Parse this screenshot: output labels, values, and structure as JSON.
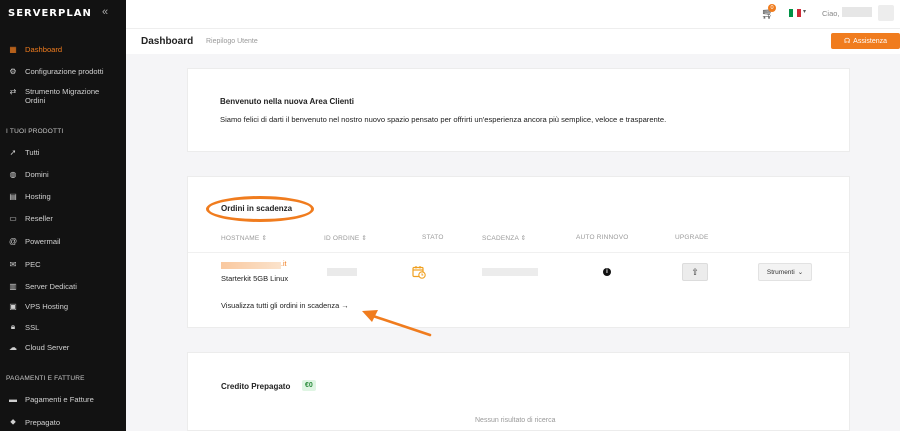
{
  "brand": {
    "logo": "SERVERPLAN",
    "collapse_icon": "«"
  },
  "sidebar": {
    "top_items": [
      {
        "label": "Dashboard",
        "icon": "grid-icon",
        "active": true
      },
      {
        "label": "Configurazione prodotti",
        "icon": "sliders-icon"
      },
      {
        "label": "Strumento Migrazione Ordini",
        "icon": "migrate-icon"
      }
    ],
    "section_products": "I TUOI PRODOTTI",
    "products": [
      {
        "label": "Tutti",
        "icon": "rocket-icon"
      },
      {
        "label": "Domini",
        "icon": "globe-icon"
      },
      {
        "label": "Hosting",
        "icon": "server-icon"
      },
      {
        "label": "Reseller",
        "icon": "reseller-icon"
      },
      {
        "label": "Powermail",
        "icon": "at-icon"
      },
      {
        "label": "PEC",
        "icon": "pec-icon"
      },
      {
        "label": "Server Dedicati",
        "icon": "dedicated-icon"
      },
      {
        "label": "VPS Hosting",
        "icon": "vps-icon"
      },
      {
        "label": "SSL",
        "icon": "lock-icon"
      },
      {
        "label": "Cloud Server",
        "icon": "cloud-icon"
      }
    ],
    "section_payments": "PAGAMENTI E FATTURE",
    "payments": [
      {
        "label": "Pagamenti e Fatture",
        "icon": "wallet-icon"
      },
      {
        "label": "Prepagato",
        "icon": "prepaid-icon"
      }
    ]
  },
  "topbar": {
    "cart_count": "0",
    "greeting": "Ciao,",
    "flag_colors": [
      "#009246",
      "#ffffff",
      "#ce2b37"
    ]
  },
  "header": {
    "title": "Dashboard",
    "subtitle": "Riepilogo Utente",
    "assist_label": "Assistenza"
  },
  "welcome": {
    "title": "Benvenuto nella nuova Area Clienti",
    "text": "Siamo felici di darti il benvenuto nel nostro nuovo spazio pensato per offrirti un'esperienza ancora più semplice, veloce e trasparente."
  },
  "orders": {
    "title": "Ordini in scadenza",
    "columns": [
      "HOSTNAME ⇕",
      "ID ORDINE ⇕",
      "STATO",
      "SCADENZA ⇕",
      "AUTO RINNOVO",
      "UPGRADE"
    ],
    "row": {
      "tld": ".it",
      "plan": "Starterkit 5GB Linux",
      "auto_renew": "i",
      "upgrade_symbol": "⇧",
      "tools_label": "Strumenti"
    },
    "view_all": "Visualizza tutti gli ordini in scadenza →"
  },
  "credit": {
    "title": "Credito Prepagato",
    "amount": "€0",
    "empty": "Nessun risultato di ricerca"
  },
  "colors": {
    "accent": "#f07c1e",
    "sidebar_bg": "#121212",
    "page_bg": "#f5f5f7"
  }
}
